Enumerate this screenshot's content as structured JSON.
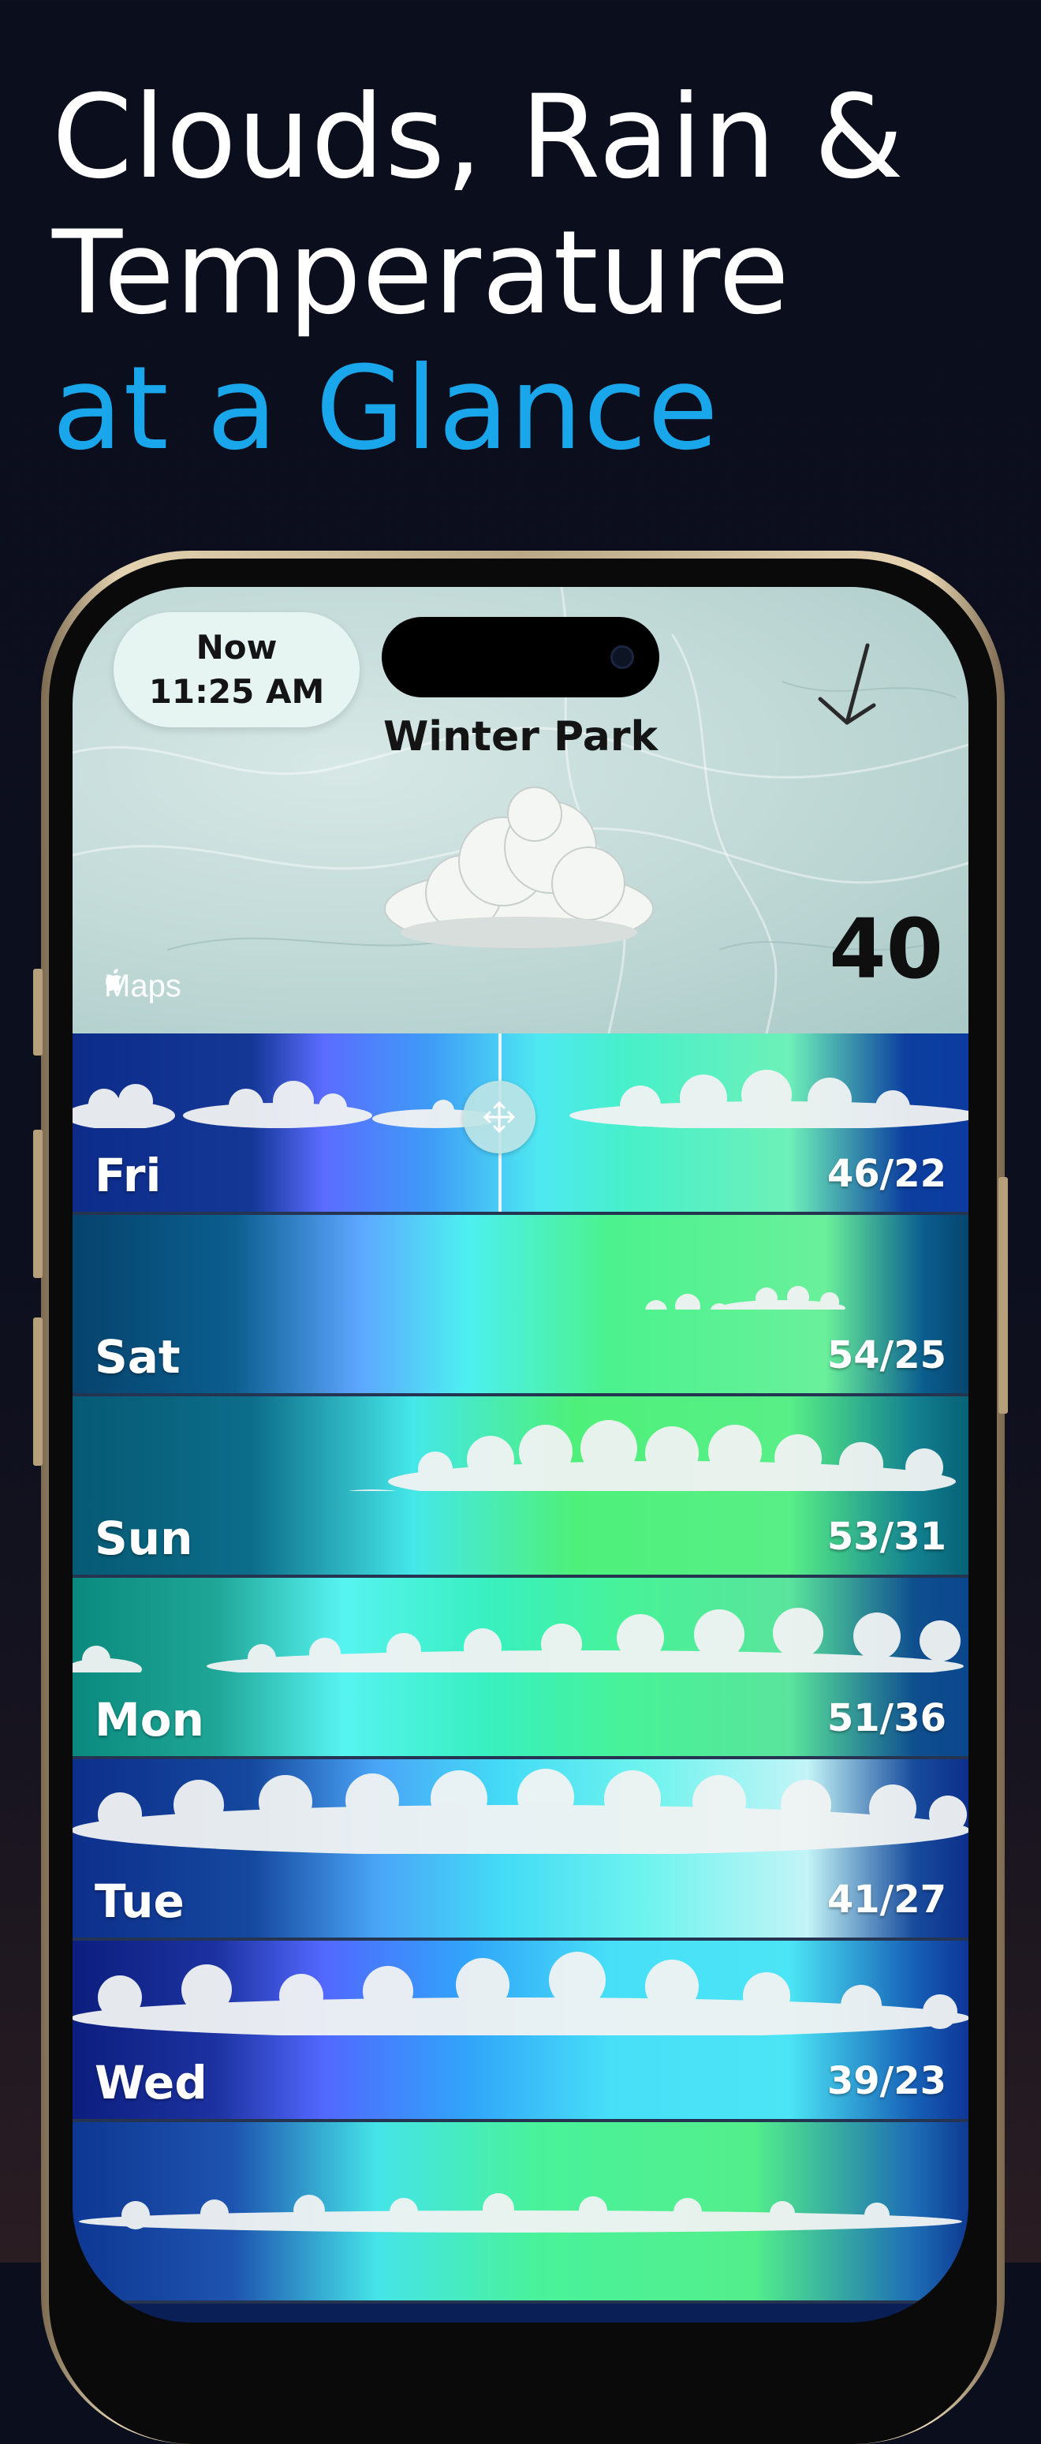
{
  "headline": {
    "line1": "Clouds, Rain &",
    "line2": "Temperature",
    "line3": "at a Glance"
  },
  "colors": {
    "accent": "#1aa6ea",
    "background": "#0b0e1c",
    "map_background": "#bfd8d6",
    "phone_frame": "#c9b592"
  },
  "status": {
    "now_label": "Now",
    "time": "11:25 AM"
  },
  "location": "Winter Park",
  "current_temp": "40",
  "map_attribution": "Maps",
  "icons": {
    "apple_logo": "apple-logo-icon",
    "wind_direction": "wind-arrow-icon",
    "scrubber": "move-arrows-icon",
    "current_condition": "cloud-icon"
  },
  "days": [
    {
      "name": "Fri",
      "temps": "46/22"
    },
    {
      "name": "Sat",
      "temps": "54/25"
    },
    {
      "name": "Sun",
      "temps": "53/31"
    },
    {
      "name": "Mon",
      "temps": "51/36"
    },
    {
      "name": "Tue",
      "temps": "41/27"
    },
    {
      "name": "Wed",
      "temps": "39/23"
    },
    {
      "name": "",
      "temps": ""
    }
  ]
}
